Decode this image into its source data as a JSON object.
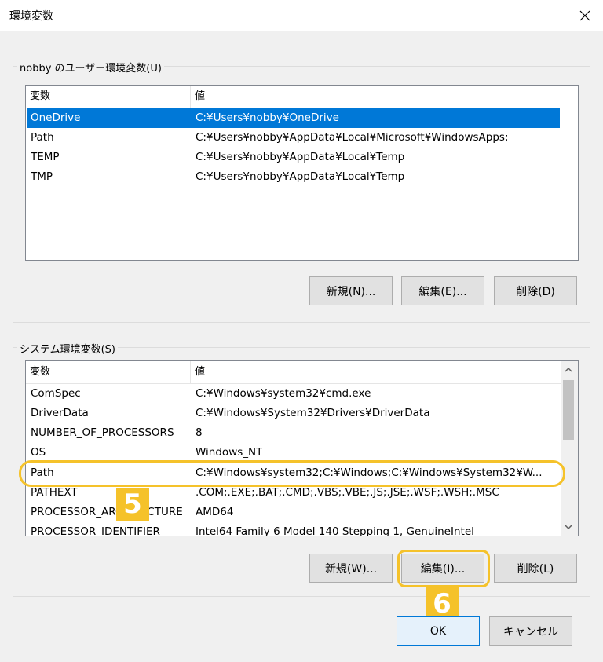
{
  "window": {
    "title": "環境変数",
    "close_icon": "close-icon"
  },
  "user_group": {
    "label": "nobby のユーザー環境変数(U)",
    "headers": {
      "name": "変数",
      "value": "値"
    },
    "rows": [
      {
        "name": "OneDrive",
        "value": "C:¥Users¥nobby¥OneDrive",
        "selected": true
      },
      {
        "name": "Path",
        "value": "C:¥Users¥nobby¥AppData¥Local¥Microsoft¥WindowsApps;"
      },
      {
        "name": "TEMP",
        "value": "C:¥Users¥nobby¥AppData¥Local¥Temp"
      },
      {
        "name": "TMP",
        "value": "C:¥Users¥nobby¥AppData¥Local¥Temp"
      }
    ],
    "buttons": {
      "new": "新規(N)...",
      "edit": "編集(E)...",
      "delete": "削除(D)"
    }
  },
  "system_group": {
    "label": "システム環境変数(S)",
    "headers": {
      "name": "変数",
      "value": "値"
    },
    "rows": [
      {
        "name": "ComSpec",
        "value": "C:¥Windows¥system32¥cmd.exe"
      },
      {
        "name": "DriverData",
        "value": "C:¥Windows¥System32¥Drivers¥DriverData"
      },
      {
        "name": "NUMBER_OF_PROCESSORS",
        "value": "8"
      },
      {
        "name": "OS",
        "value": "Windows_NT"
      },
      {
        "name": "Path",
        "value": "C:¥Windows¥system32;C:¥Windows;C:¥Windows¥System32¥W..."
      },
      {
        "name": "PATHEXT",
        "value": ".COM;.EXE;.BAT;.CMD;.VBS;.VBE;.JS;.JSE;.WSF;.WSH;.MSC"
      },
      {
        "name": "PROCESSOR_ARCHITECTURE",
        "value": "AMD64"
      },
      {
        "name": "PROCESSOR_IDENTIFIER",
        "value": "Intel64 Family 6 Model 140 Stepping 1, GenuineIntel"
      }
    ],
    "buttons": {
      "new": "新規(W)...",
      "edit": "編集(I)...",
      "delete": "削除(L)"
    },
    "scroll_up_icon": "chevron-up-icon",
    "scroll_down_icon": "chevron-down-icon"
  },
  "annotations": {
    "step5": "5",
    "step6": "6",
    "highlight_color": "#f5c22a"
  },
  "footer": {
    "ok": "OK",
    "cancel": "キャンセル"
  },
  "colors": {
    "selection": "#0078d7",
    "dialog_bg": "#f0f0f0"
  }
}
